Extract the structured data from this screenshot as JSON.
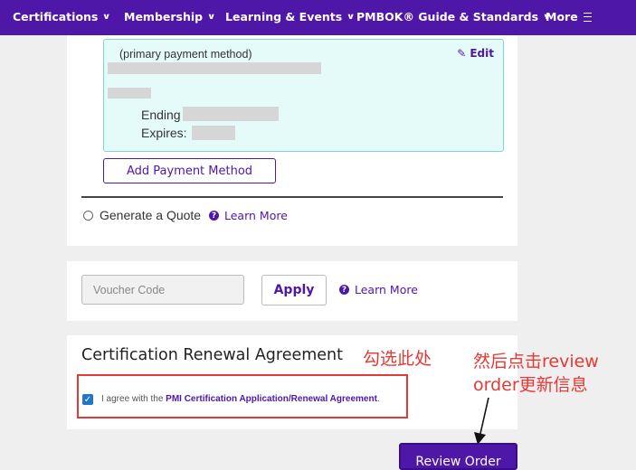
{
  "nav": {
    "items": [
      {
        "label": "Certifications",
        "icon": "chevron-down-icon"
      },
      {
        "label": "Membership",
        "icon": "chevron-down-icon"
      },
      {
        "label": "Learning & Events",
        "icon": "chevron-down-icon"
      },
      {
        "label": "PMBOK® Guide & Standards",
        "icon": "chevron-down-icon"
      },
      {
        "label": "More",
        "icon": "menu-icon"
      }
    ]
  },
  "payment": {
    "method_label": "(primary payment method)",
    "edit_label": "Edit",
    "ending_label": "Ending",
    "expires_label": "Expires:",
    "add_label": "Add Payment Method",
    "quote_label": "Generate a Quote",
    "learn_more": "Learn More"
  },
  "voucher": {
    "placeholder": "Voucher Code",
    "apply_label": "Apply",
    "learn_more": "Learn More"
  },
  "agreement": {
    "title": "Certification Renewal Agreement",
    "checkbox_checked": true,
    "text_prefix": "I agree with the ",
    "link_text": "PMI Certification Application/Renewal Agreement",
    "text_suffix": "."
  },
  "annotations": {
    "check_here": "勾选此处",
    "then_click_line1": "然后点击review",
    "then_click_line2": "order更新信息"
  },
  "review_label": "Review Order",
  "colors": {
    "brand": "#4f17a8",
    "annotation_red": "#e53935",
    "payment_box": "#e5fbfa"
  }
}
